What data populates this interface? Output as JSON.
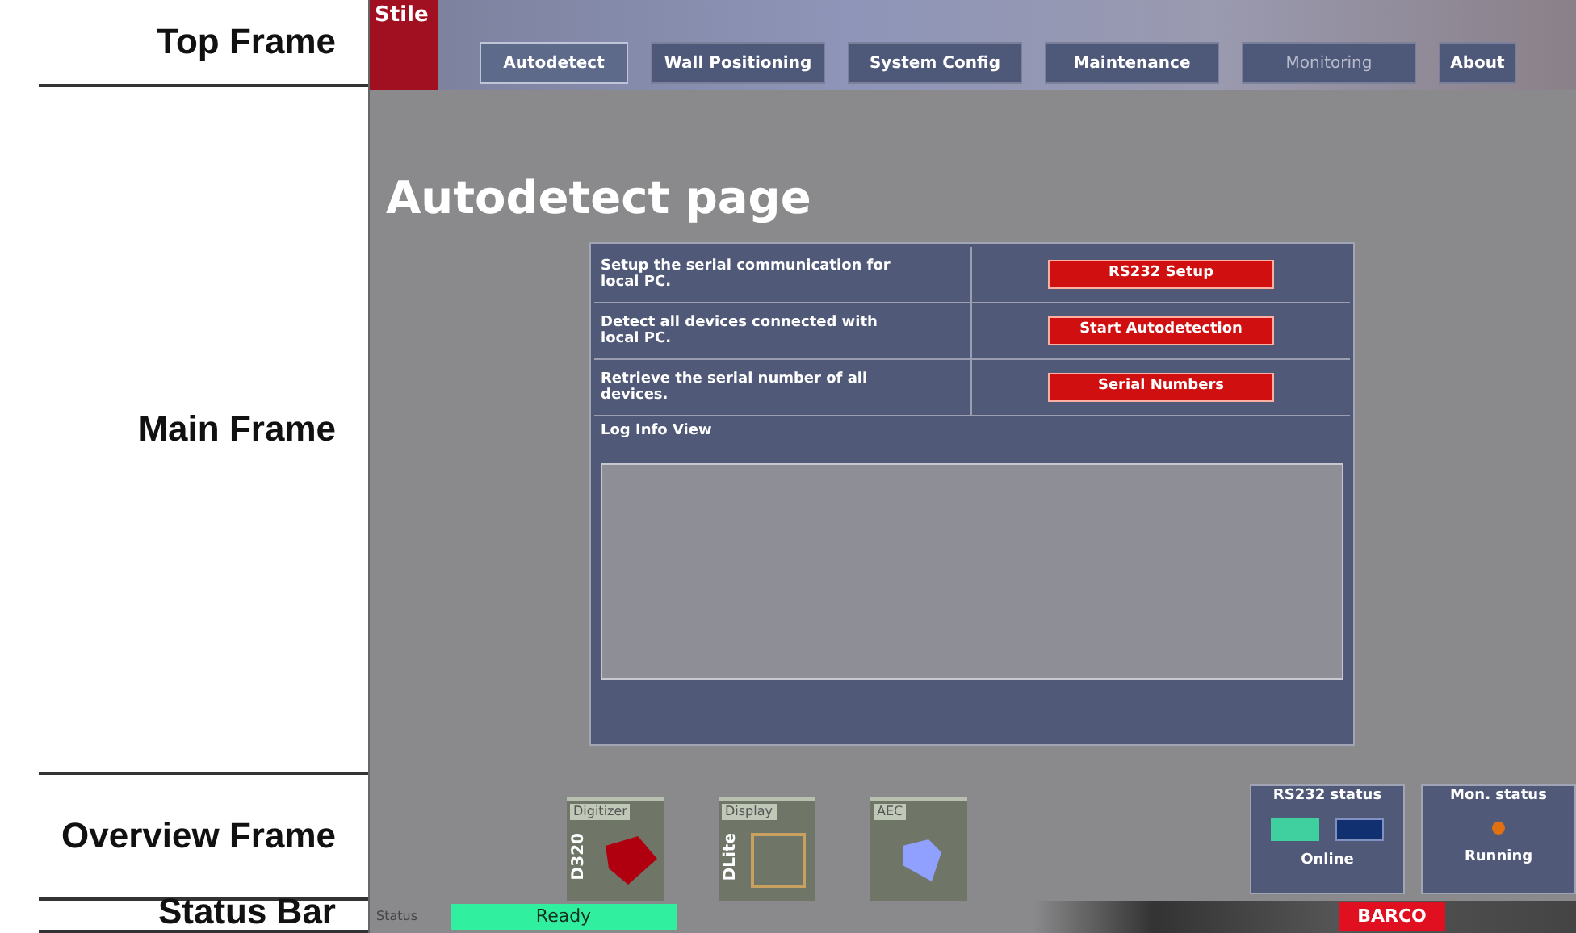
{
  "annotations": [
    {
      "label": "Top Frame",
      "kind": "top"
    },
    {
      "label": "Main Frame",
      "kind": "main"
    },
    {
      "label": "Overview Frame",
      "kind": "overview"
    },
    {
      "label": "Status Bar",
      "kind": "status"
    }
  ],
  "top_frame": {
    "logo": "Stile",
    "tabs": [
      {
        "label": "Autodetect",
        "selected": true,
        "disabled": false
      },
      {
        "label": "Wall Positioning",
        "selected": false,
        "disabled": false
      },
      {
        "label": "System Config",
        "selected": false,
        "disabled": false
      },
      {
        "label": "Maintenance",
        "selected": false,
        "disabled": false
      },
      {
        "label": "Monitoring",
        "selected": false,
        "disabled": true
      },
      {
        "label": "About",
        "selected": false,
        "disabled": false
      }
    ]
  },
  "main_frame": {
    "title": "Autodetect page",
    "rows": [
      {
        "description": "Setup the serial communication for local PC.",
        "button": "RS232 Setup"
      },
      {
        "description": "Detect all devices connected with local PC.",
        "button": "Start Autodetection"
      },
      {
        "description": "Retrieve the serial number of all devices.",
        "button": "Serial Numbers"
      }
    ],
    "log_label": "Log Info View"
  },
  "overview_frame": {
    "devices": [
      {
        "tag": "Digitizer",
        "name": "D320",
        "kind": "digitizer"
      },
      {
        "tag": "Display",
        "name": "DLite",
        "kind": "display"
      },
      {
        "tag": "AEC",
        "kind": "aec"
      }
    ],
    "rs232_status": {
      "title": "RS232 status",
      "state": "Online"
    },
    "mon_status": {
      "title": "Mon. status",
      "state": "Running"
    }
  },
  "status_bar": {
    "label": "Status",
    "value": "Ready",
    "logo": "BARCO"
  }
}
